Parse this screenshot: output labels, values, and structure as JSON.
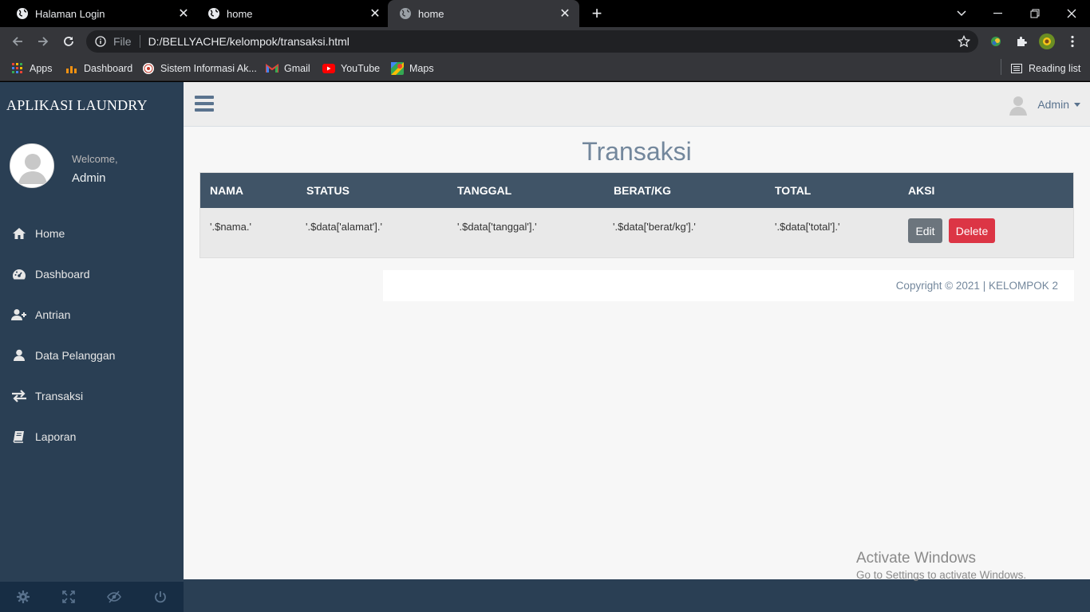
{
  "browser": {
    "tabs": [
      {
        "title": "Halaman Login"
      },
      {
        "title": "home"
      },
      {
        "title": "home"
      }
    ],
    "address": {
      "scheme": "File",
      "url": "D:/BELLYACHE/kelompok/transaksi.html"
    },
    "bookmarks": [
      {
        "label": "Apps"
      },
      {
        "label": "Dashboard"
      },
      {
        "label": "Sistem Informasi Ak..."
      },
      {
        "label": "Gmail"
      },
      {
        "label": "YouTube"
      },
      {
        "label": "Maps"
      }
    ],
    "reading_list": "Reading list"
  },
  "sidebar": {
    "brand": "APLIKASI LAUNDRY",
    "welcome": "Welcome,",
    "user_name": "Admin",
    "items": [
      {
        "label": "Home",
        "icon": "home-icon"
      },
      {
        "label": "Dashboard",
        "icon": "dashboard-icon"
      },
      {
        "label": "Antrian",
        "icon": "user-plus-icon"
      },
      {
        "label": "Data Pelanggan",
        "icon": "user-icon"
      },
      {
        "label": "Transaksi",
        "icon": "exchange-icon"
      },
      {
        "label": "Laporan",
        "icon": "book-icon"
      }
    ]
  },
  "topnav": {
    "user": "Admin"
  },
  "main": {
    "title": "Transaksi",
    "table": {
      "headers": [
        "NAMA",
        "STATUS",
        "TANGGAL",
        "BERAT/KG",
        "TOTAL",
        "AKSI"
      ],
      "rows": [
        {
          "nama": "'.$nama.'",
          "status": "'.$data['alamat'].'",
          "tanggal": "'.$data['tanggal'].'",
          "berat": "'.$data['berat/kg'].'",
          "total": "'.$data['total'].'",
          "edit_label": "Edit",
          "delete_label": "Delete"
        }
      ]
    },
    "footer": "Copyright © 2021 | KELOMPOK 2"
  },
  "os_overlay": {
    "line1": "Activate Windows",
    "line2": "Go to Settings to activate Windows."
  },
  "colors": {
    "sidebar": "#2a3f54",
    "table_header": "#405467",
    "edit_button": "#6c757d",
    "delete_button": "#dc3545"
  }
}
